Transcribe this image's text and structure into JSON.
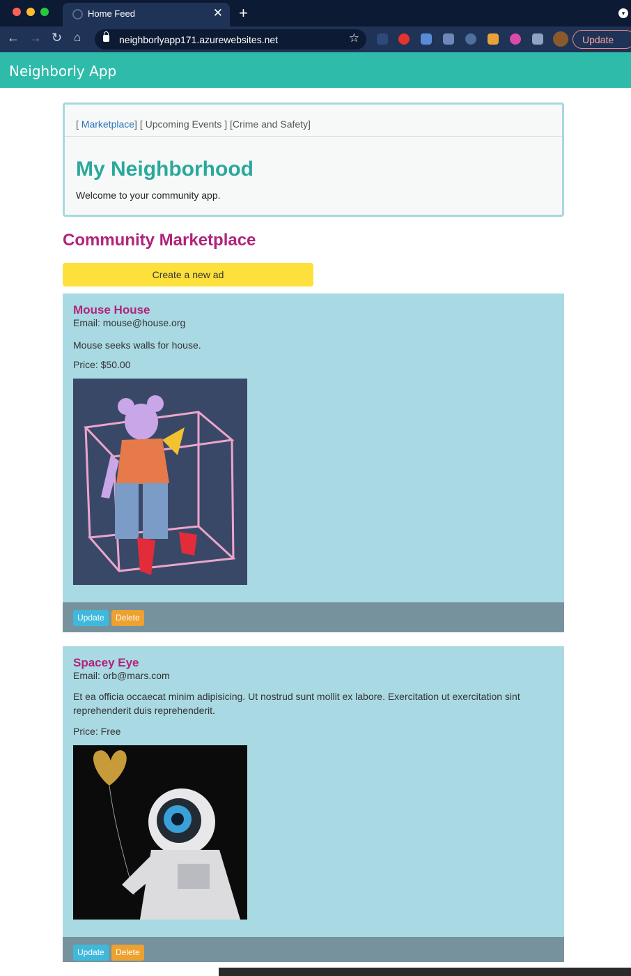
{
  "browser": {
    "tab_title": "Home Feed",
    "url": "neighborlyapp171.azurewebsites.net",
    "update_label": "Update"
  },
  "app": {
    "brand": "Neighborly App"
  },
  "panel": {
    "nav_open1": "[ ",
    "nav_marketplace": "Marketplace",
    "nav_rest": "] [ Upcoming Events ] [Crime and Safety]",
    "heading": "My Neighborhood",
    "subtitle": "Welcome to your community app."
  },
  "marketplace": {
    "title": "Community Marketplace",
    "create_label": "Create a new ad",
    "ads": [
      {
        "title": "Mouse House",
        "email": "Email: mouse@house.org",
        "description": "Mouse seeks walls for house.",
        "price": "Price: $50.00",
        "image": "mouse-in-neon-cube-photo",
        "update_label": "Update",
        "delete_label": "Delete"
      },
      {
        "title": "Spacey Eye",
        "email": "Email: orb@mars.com",
        "description": "Et ea officia occaecat minim adipisicing. Ut nostrud sunt mollit ex labore. Exercitation ut exercitation sint reprehenderit duis reprehenderit.",
        "price": "Price: Free",
        "image": "astronaut-eye-balloon-photo",
        "update_label": "Update",
        "delete_label": "Delete"
      }
    ]
  },
  "colors": {
    "appbar": "#2fbbaa",
    "heading_teal": "#2aa89c",
    "title_magenta": "#b1237a",
    "card_bg": "#a9d9e3",
    "create_button": "#fde03b"
  }
}
